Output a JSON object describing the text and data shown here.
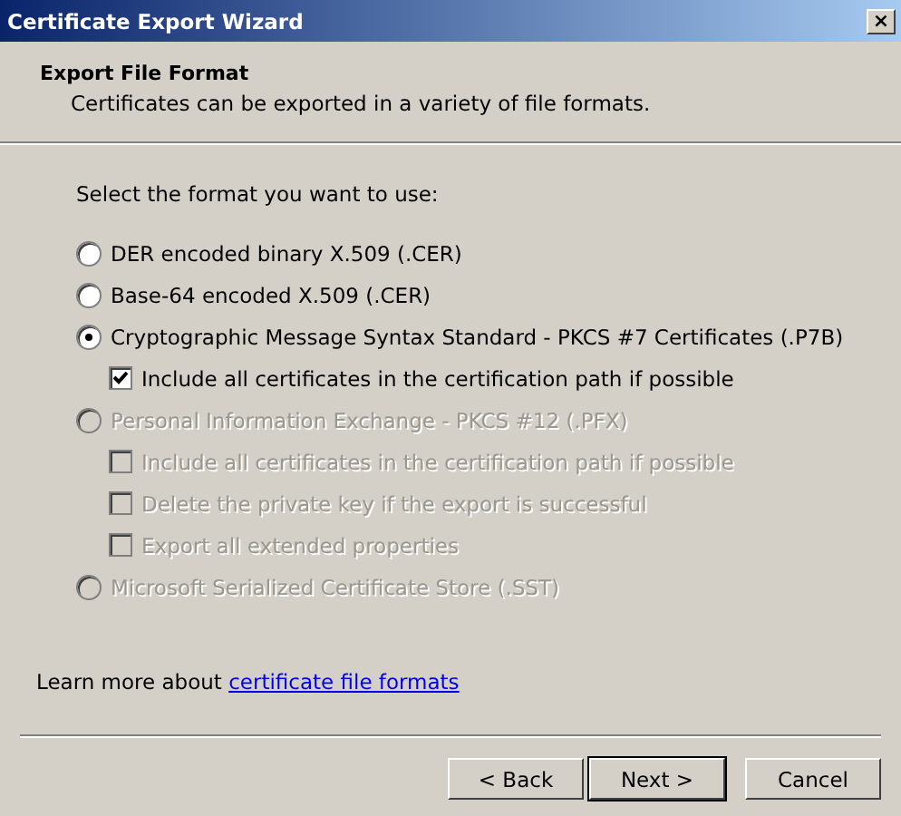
{
  "window": {
    "title": "Certificate Export Wizard",
    "close": "×"
  },
  "header": {
    "title": "Export File Format",
    "subtitle": "Certificates can be exported in a variety of file formats."
  },
  "prompt": "Select the format you want to use:",
  "formats": [
    {
      "label": "DER encoded binary X.509 (.CER)",
      "selected": false,
      "disabled": false
    },
    {
      "label": "Base-64 encoded X.509 (.CER)",
      "selected": false,
      "disabled": false
    },
    {
      "label": "Cryptographic Message Syntax Standard - PKCS #7 Certificates (.P7B)",
      "selected": true,
      "disabled": false,
      "options": [
        {
          "label": "Include all certificates in the certification path if possible",
          "checked": true,
          "disabled": false
        }
      ]
    },
    {
      "label": "Personal Information Exchange - PKCS #12 (.PFX)",
      "selected": false,
      "disabled": true,
      "options": [
        {
          "label": "Include all certificates in the certification path if possible",
          "checked": false,
          "disabled": true
        },
        {
          "label": "Delete the private key if the export is successful",
          "checked": false,
          "disabled": true
        },
        {
          "label": "Export all extended properties",
          "checked": false,
          "disabled": true
        }
      ]
    },
    {
      "label": "Microsoft Serialized Certificate Store (.SST)",
      "selected": false,
      "disabled": true
    }
  ],
  "learn_more": {
    "text": "Learn more about",
    "link": "certificate file formats"
  },
  "buttons": [
    {
      "label": "< Back",
      "default": false
    },
    {
      "label": "Next >",
      "default": true
    },
    {
      "label": "Cancel",
      "default": false
    }
  ]
}
